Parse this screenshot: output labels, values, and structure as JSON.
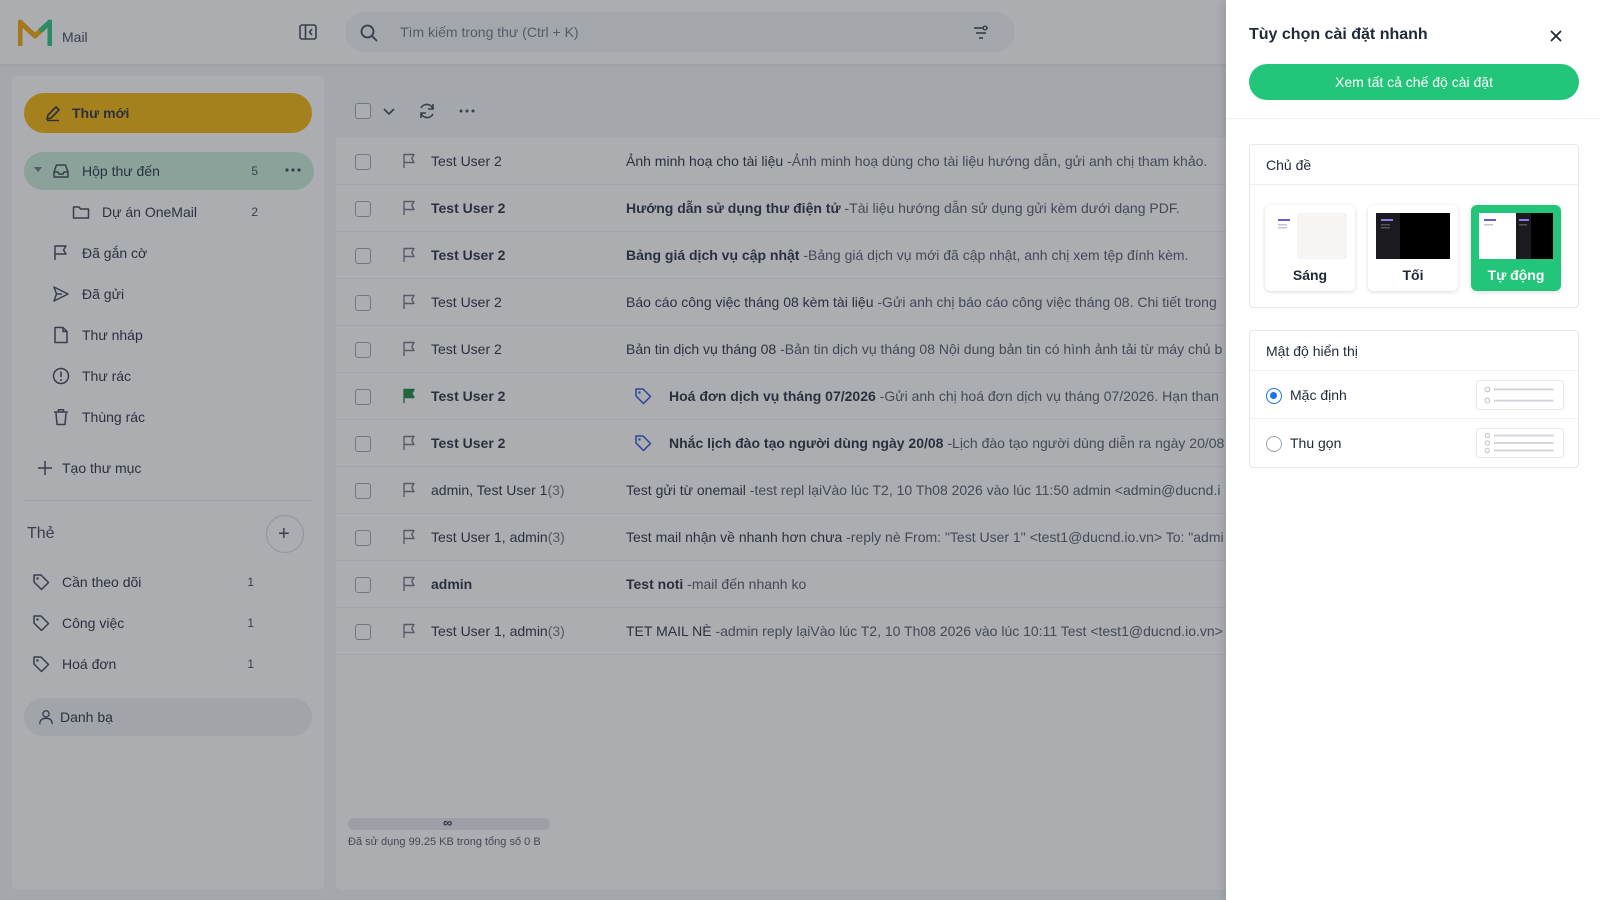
{
  "app": {
    "logo_text": "Mail"
  },
  "search": {
    "placeholder": "Tìm kiếm trong thư (Ctrl + K)"
  },
  "sidebar": {
    "compose_label": "Thư mới",
    "inbox": {
      "label": "Hộp thư đến",
      "count": "5"
    },
    "subfolder": {
      "label": "Dự án OneMail",
      "count": "2"
    },
    "items": [
      {
        "label": "Đã gắn cờ",
        "icon": "flag-icon"
      },
      {
        "label": "Đã gửi",
        "icon": "send-icon"
      },
      {
        "label": "Thư nháp",
        "icon": "draft-icon"
      },
      {
        "label": "Thư rác",
        "icon": "spam-icon"
      },
      {
        "label": "Thùng rác",
        "icon": "trash-icon"
      }
    ],
    "create_folder_label": "Tạo thư mục",
    "tags_title": "Thẻ",
    "tags": [
      {
        "label": "Cần theo dõi",
        "count": "1"
      },
      {
        "label": "Công việc",
        "count": "1"
      },
      {
        "label": "Hoá đơn",
        "count": "1"
      }
    ],
    "contacts_label": "Danh bạ"
  },
  "mails": [
    {
      "sender": "Test User 2",
      "count": "",
      "subject": "Ảnh minh hoạ cho tài liệu",
      "preview": " -Ảnh minh hoạ dùng cho tài liệu hướng dẫn, gửi anh chị tham khảo.",
      "unread": false,
      "flagged": false,
      "tagged": false
    },
    {
      "sender": "Test User 2",
      "count": "",
      "subject": "Hướng dẫn sử dụng thư điện tử",
      "preview": " -Tài liệu hướng dẫn sử dụng gửi kèm dưới dạng PDF.",
      "unread": true,
      "flagged": false,
      "tagged": false
    },
    {
      "sender": "Test User 2",
      "count": "",
      "subject": "Bảng giá dịch vụ cập nhật",
      "preview": " -Bảng giá dịch vụ mới đã cập nhật, anh chị xem tệp đính kèm.",
      "unread": true,
      "flagged": false,
      "tagged": false
    },
    {
      "sender": "Test User 2",
      "count": "",
      "subject": "Báo cáo công việc tháng 08 kèm tài liệu",
      "preview": " -Gửi anh chị báo cáo công việc tháng 08. Chi tiết trong",
      "unread": false,
      "flagged": false,
      "tagged": false
    },
    {
      "sender": "Test User 2",
      "count": "",
      "subject": "Bản tin dịch vụ tháng 08",
      "preview": " -Bản tin dịch vụ tháng 08 Nội dung bản tin có hình ảnh tải từ máy chủ b",
      "unread": false,
      "flagged": false,
      "tagged": false
    },
    {
      "sender": "Test User 2",
      "count": "",
      "subject": "Hoá đơn dịch vụ tháng 07/2026",
      "preview": " -Gửi anh chị hoá đơn dịch vụ tháng 07/2026. Hạn than",
      "unread": true,
      "flagged": true,
      "tagged": true
    },
    {
      "sender": "Test User 2",
      "count": "",
      "subject": "Nhắc lịch đào tạo người dùng ngày 20/08",
      "preview": " -Lịch đào tạo người dùng diễn ra ngày 20/08",
      "unread": true,
      "flagged": false,
      "tagged": true
    },
    {
      "sender": "admin, Test User 1",
      "count": "(3)",
      "subject": "Test gửi từ onemail",
      "preview": " -test repl lạiVào lúc T2, 10 Th08 2026 vào lúc 11:50 admin <admin@ducnd.i",
      "unread": false,
      "flagged": false,
      "tagged": false
    },
    {
      "sender": "Test User 1, admin",
      "count": "(3)",
      "subject": "Test mail nhận về nhanh hơn chưa",
      "preview": " -reply nè From: \"Test User 1\" <test1@ducnd.io.vn> To: \"admi",
      "unread": false,
      "flagged": false,
      "tagged": false
    },
    {
      "sender": "admin",
      "count": "",
      "subject": "Test noti",
      "preview": " -mail đến nhanh ko",
      "unread": true,
      "flagged": false,
      "tagged": false
    },
    {
      "sender": "Test User 1, admin",
      "count": "(3)",
      "subject": "TET MAIL NÈ",
      "preview": " -admin reply lạiVào lúc T2, 10 Th08 2026 vào lúc 10:11 Test <test1@ducnd.io.vn>",
      "unread": false,
      "flagged": false,
      "tagged": false
    }
  ],
  "storage": {
    "limit_symbol": "∞",
    "text": "Đã sử dụng 99.25 KB trong tổng số 0 B"
  },
  "settings": {
    "title": "Tùy chọn cài đặt nhanh",
    "view_all_label": "Xem tất cả chế độ cài đặt",
    "theme_title": "Chủ đề",
    "themes": [
      {
        "label": "Sáng",
        "selected": false
      },
      {
        "label": "Tối",
        "selected": false
      },
      {
        "label": "Tự động",
        "selected": true
      }
    ],
    "density_title": "Mật độ hiển thị",
    "densities": [
      {
        "label": "Mặc định",
        "selected": true
      },
      {
        "label": "Thu gọn",
        "selected": false
      }
    ]
  },
  "colors": {
    "accent": "#22c57a",
    "compose": "#f5b400",
    "active_nav": "#c9ecd8",
    "flag_active": "#15803d",
    "radio": "#1a73e8"
  }
}
